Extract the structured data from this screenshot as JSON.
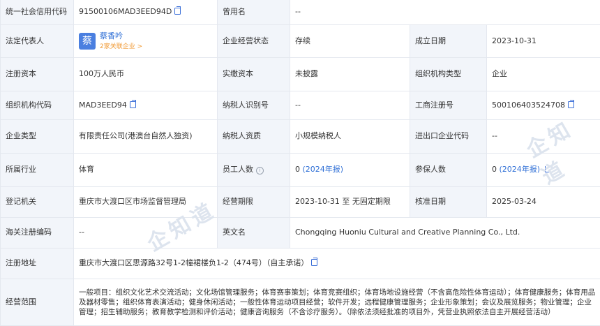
{
  "rows": [
    {
      "label1": "统一社会信用代码",
      "value1": "91500106MAD3EED94D",
      "label2": "曾用名",
      "value2": "--"
    },
    {
      "label1": "法定代表人",
      "rep_avatar": "蔡",
      "rep_name": "蔡香吟",
      "rep_link": "2家关联企业 >",
      "label2": "企业经营状态",
      "value2": "存续",
      "label3": "成立日期",
      "value3": "2023-10-31"
    },
    {
      "label1": "注册资本",
      "value1": "100万人民币",
      "label2": "实缴资本",
      "value2": "未披露",
      "label3": "组织机构类型",
      "value3": "企业"
    },
    {
      "label1": "组织机构代码",
      "value1": "MAD3EED94",
      "label2": "纳税人识别号",
      "value2": "--",
      "label3": "工商注册号",
      "value3": "500106403524708"
    },
    {
      "label1": "企业类型",
      "value1": "有限责任公司(港澳台自然人独资)",
      "label2": "纳税人资质",
      "value2": "小规模纳税人",
      "label3": "进出口企业代码",
      "value3": "--"
    },
    {
      "label1": "所属行业",
      "value1": "体育",
      "label2": "员工人数",
      "value2_num": "0",
      "value2_link": "(2024年报)",
      "label3": "参保人数",
      "value3_num": "0",
      "value3_link": "(2024年报)"
    },
    {
      "label1": "登记机关",
      "value1": "重庆市大渡口区市场监督管理局",
      "label2": "经营期限",
      "value2": "2023-10-31 至 无固定期限",
      "label3": "核准日期",
      "value3": "2025-03-24"
    },
    {
      "label1": "海关注册编码",
      "value1": "--",
      "label2": "英文名",
      "value2": "Chongqing Huoniu Cultural and Creative Planning Co., Ltd."
    },
    {
      "label1": "注册地址",
      "value1": "重庆市大渡口区思源路32号1-2幢裙楼负1-2（474号）（自主承诺）"
    },
    {
      "label1": "经营范围",
      "value1": "一般项目：组织文化艺术交流活动；文化场馆管理服务；体育赛事策划；体育竞赛组织；体育场地设施经营（不含高危险性体育运动）；体育健康服务；体育用品及器材零售；组织体育表演活动；健身休闲活动；一般性体育运动项目经营；软件开发；远程健康管理服务；企业形象策划；会议及展览服务；物业管理；企业管理；招生辅助服务；教育教学检测和评价活动；健康咨询服务（不含诊疗服务）。（除依法须经批准的项目外，凭营业执照依法自主开展经营活动）"
    }
  ],
  "watermark": "企知道",
  "colors": {
    "label_bg": "#f2f5fa",
    "border": "#e4e8ef",
    "link": "#2f6fd6",
    "accent_orange": "#f19a34"
  }
}
